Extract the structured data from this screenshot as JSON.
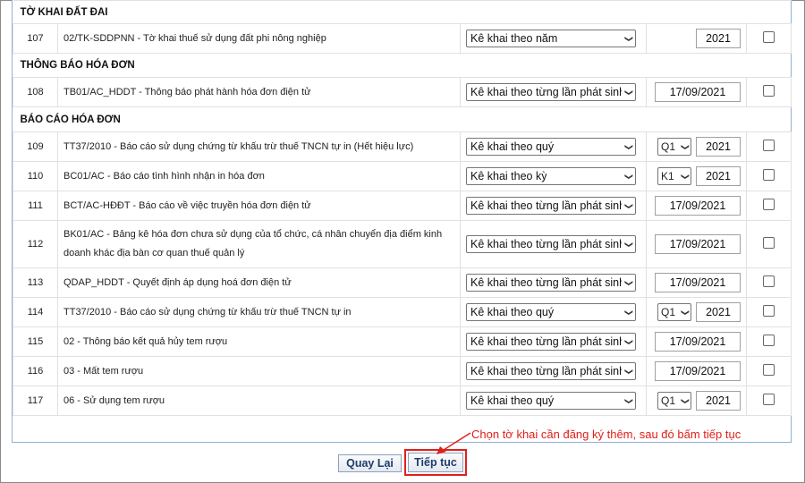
{
  "sections": [
    {
      "title": "TỜ KHAI ĐẤT ĐAI",
      "rows": [
        {
          "num": "107",
          "name": "02/TK-SDDPNN - Tờ khai thuế sử dụng đất phi nông nghiệp",
          "freq": "Kê khai theo năm",
          "period": "",
          "year": "2021",
          "date": ""
        }
      ]
    },
    {
      "title": "THÔNG BÁO HÓA ĐƠN",
      "rows": [
        {
          "num": "108",
          "name": "TB01/AC_HDDT - Thông báo phát hành hóa đơn điện tử",
          "freq": "Kê khai theo từng lần phát sinh",
          "period": "",
          "year": "",
          "date": "17/09/2021"
        }
      ]
    },
    {
      "title": "BÁO CÁO HÓA ĐƠN",
      "rows": [
        {
          "num": "109",
          "name": "TT37/2010 - Báo cáo sử dụng chứng từ khấu trừ thuế TNCN tự in (Hết hiệu lực)",
          "freq": "Kê khai theo quý",
          "period": "Q1",
          "year": "2021",
          "date": ""
        },
        {
          "num": "110",
          "name": "BC01/AC - Báo cáo tình hình nhận in hóa đơn",
          "freq": "Kê khai theo kỳ",
          "period": "K1",
          "year": "2021",
          "date": ""
        },
        {
          "num": "111",
          "name": "BCT/AC-HĐĐT - Báo cáo về việc truyền hóa đơn điện tử",
          "freq": "Kê khai theo từng lần phát sinh",
          "period": "",
          "year": "",
          "date": "17/09/2021"
        },
        {
          "num": "112",
          "name": "BK01/AC - Bảng kê hóa đơn chưa sử dụng của tổ chức, cá nhân chuyển địa điểm kinh doanh khác địa bàn cơ quan thuế quản lý",
          "freq": "Kê khai theo từng lần phát sinh",
          "period": "",
          "year": "",
          "date": "17/09/2021"
        },
        {
          "num": "113",
          "name": "QDAP_HDDT - Quyết định áp dụng hoá đơn điện tử",
          "freq": "Kê khai theo từng lần phát sinh",
          "period": "",
          "year": "",
          "date": "17/09/2021"
        },
        {
          "num": "114",
          "name": "TT37/2010 - Báo cáo sử dụng chứng từ khấu trừ thuế TNCN tự in",
          "freq": "Kê khai theo quý",
          "period": "Q1",
          "year": "2021",
          "date": ""
        },
        {
          "num": "115",
          "name": "02 - Thông báo kết quả hủy tem rượu",
          "freq": "Kê khai theo từng lần phát sinh",
          "period": "",
          "year": "",
          "date": "17/09/2021"
        },
        {
          "num": "116",
          "name": "03 - Mất tem rượu",
          "freq": "Kê khai theo từng lần phát sinh",
          "period": "",
          "year": "",
          "date": "17/09/2021"
        },
        {
          "num": "117",
          "name": "06 - Sử dụng tem rượu",
          "freq": "Kê khai theo quý",
          "period": "Q1",
          "year": "2021",
          "date": ""
        }
      ]
    }
  ],
  "buttons": {
    "back": "Quay Lại",
    "next": "Tiếp tục"
  },
  "annotation": {
    "text": "Chọn tờ khai cần đăng ký thêm, sau đó bấm tiếp tục",
    "color": "#e0201a"
  }
}
